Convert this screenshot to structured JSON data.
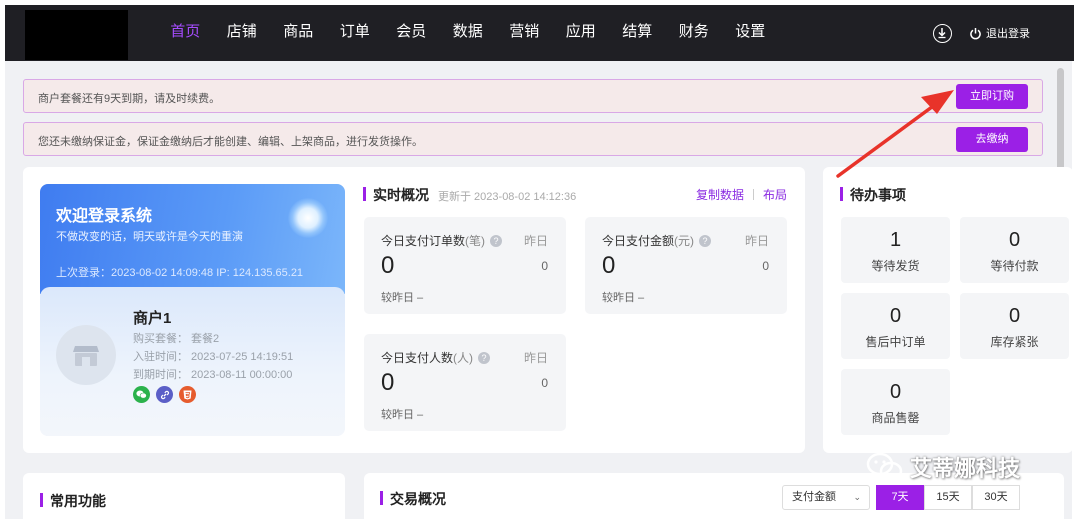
{
  "nav": {
    "items": [
      "首页",
      "店铺",
      "商品",
      "订单",
      "会员",
      "数据",
      "营销",
      "应用",
      "结算",
      "财务",
      "设置"
    ],
    "active_index": 0,
    "logout_label": "退出登录"
  },
  "alerts": {
    "expire_msg": "商户套餐还有9天到期，请及时续费。",
    "expire_btn": "立即订购",
    "deposit_msg": "您还未缴纳保证金，保证金缴纳后才能创建、编辑、上架商品，进行发货操作。",
    "deposit_btn": "去缴纳"
  },
  "welcome": {
    "title": "欢迎登录系统",
    "subtitle": "不做改变的话，明天或许是今天的重演",
    "last_login": "上次登录：2023-08-02 14:09:48 IP: 124.135.65.21"
  },
  "merchant": {
    "name": "商户1",
    "package": "购买套餐：  套餐2",
    "joined": "入驻时间：  2023-07-25 14:19:51",
    "expires": "到期时间：  2023-08-11 00:00:00",
    "badge_icons": [
      "wechat-icon",
      "link-icon",
      "html5-icon"
    ],
    "badge_colors": [
      "#2bb24c",
      "#5b5fc7",
      "#e65c2e"
    ]
  },
  "realtime": {
    "title": "实时概况",
    "updated": "更新于 2023-08-02 14:12:36",
    "copy_label": "复制数据",
    "layout_label": "布局",
    "stats": [
      {
        "label": "今日支付订单数",
        "unit": "(笔)",
        "yesterday_label": "昨日",
        "value": "0",
        "yesterday_value": "0",
        "compare": "较昨日 –"
      },
      {
        "label": "今日支付金额",
        "unit": "(元)",
        "yesterday_label": "昨日",
        "value": "0",
        "yesterday_value": "0",
        "compare": "较昨日 –"
      },
      {
        "label": "今日支付人数",
        "unit": "(人)",
        "yesterday_label": "昨日",
        "value": "0",
        "yesterday_value": "0",
        "compare": "较昨日 –"
      }
    ]
  },
  "todo": {
    "title": "待办事项",
    "items": [
      {
        "count": "1",
        "label": "等待发货"
      },
      {
        "count": "0",
        "label": "等待付款"
      },
      {
        "count": "0",
        "label": "售后中订单"
      },
      {
        "count": "0",
        "label": "库存紧张"
      },
      {
        "count": "0",
        "label": "商品售罄"
      }
    ]
  },
  "common": {
    "title": "常用功能"
  },
  "trade": {
    "title": "交易概况",
    "metric_selected": "支付金额",
    "ranges": [
      "7天",
      "15天",
      "30天"
    ],
    "range_active": 0
  },
  "watermark": {
    "text": "艾蒂娜科技"
  },
  "colors": {
    "accent": "#9b20e6",
    "nav_bg": "#1f1f24",
    "arrow": "#e8332a"
  }
}
